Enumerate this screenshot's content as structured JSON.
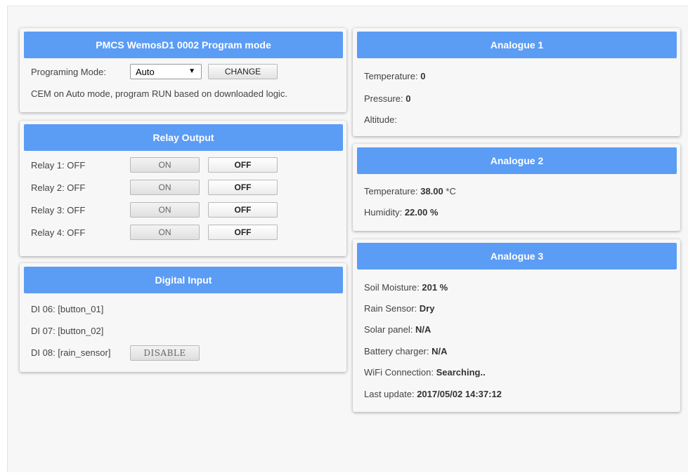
{
  "program_card": {
    "title": "PMCS WemosD1 0002 Program mode",
    "mode_label": "Programing Mode:",
    "mode_value": "Auto",
    "change_label": "CHANGE",
    "description": "CEM on Auto mode, program RUN based on downloaded logic."
  },
  "relay_card": {
    "title": "Relay Output",
    "relays": [
      {
        "label": "Relay 1: OFF",
        "on": "ON",
        "off": "OFF"
      },
      {
        "label": "Relay 2: OFF",
        "on": "ON",
        "off": "OFF"
      },
      {
        "label": "Relay 3: OFF",
        "on": "ON",
        "off": "OFF"
      },
      {
        "label": "Relay 4: OFF",
        "on": "ON",
        "off": "OFF"
      }
    ]
  },
  "digital_card": {
    "title": "Digital Input",
    "inputs": [
      {
        "label": "DI 06: [button_01]"
      },
      {
        "label": "DI 07: [button_02]"
      },
      {
        "label": "DI 08: [rain_sensor]",
        "button": "DISABLE"
      }
    ]
  },
  "analogue1": {
    "title": "Analogue 1",
    "temperature_label": "Temperature:",
    "temperature_value": "0",
    "pressure_label": "Pressure:",
    "pressure_value": "0",
    "altitude_label": "Altitude:"
  },
  "analogue2": {
    "title": "Analogue 2",
    "temperature_label": "Temperature:",
    "temperature_value": "38.00",
    "temperature_unit": "*C",
    "humidity_label": "Humidity:",
    "humidity_value": "22.00 %"
  },
  "analogue3": {
    "title": "Analogue 3",
    "rows": [
      {
        "label": "Soil Moisture:",
        "value": "201 %"
      },
      {
        "label": "Rain Sensor:",
        "value": "Dry"
      },
      {
        "label": "Solar panel:",
        "value": "N/A"
      },
      {
        "label": "Battery charger:",
        "value": "N/A"
      },
      {
        "label": "WiFi Connection:",
        "value": "Searching.."
      },
      {
        "label": "Last update:",
        "value": "2017/05/02 14:37:12"
      }
    ]
  },
  "colors": {
    "header": "#5b9cf5",
    "background": "#f7f7f7"
  },
  "icons": {
    "select_arrow": "caret-down-icon"
  }
}
